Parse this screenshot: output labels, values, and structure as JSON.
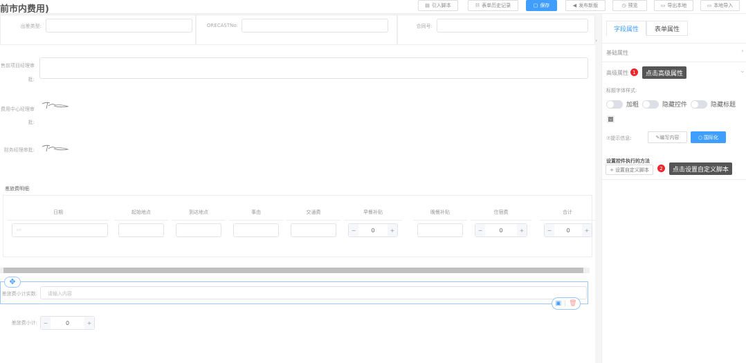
{
  "header": {
    "title": "前市内费用)"
  },
  "toolbar": [
    {
      "label": "引入脚本",
      "icon": "▤"
    },
    {
      "label": "表单历史记录",
      "icon": "☷"
    },
    {
      "label": "保存",
      "icon": "▢"
    },
    {
      "label": "发布新版",
      "icon": "◀"
    },
    {
      "label": "预览",
      "icon": "◷"
    },
    {
      "label": "导出本地",
      "icon": "▭"
    },
    {
      "label": "本地导入",
      "icon": "▭"
    }
  ],
  "form": {
    "trip_type_label": "出差类型:",
    "forecast_label": "ORECASTNo:",
    "contract_label": "合同号:",
    "presales_label_1": "售前项目经理审",
    "presales_label_2": "批:",
    "cost_center_label_1": "费用中心经理审",
    "cost_center_label_2": "批:",
    "finance_label": "财务经理审批:",
    "section_title": "差旅费明细",
    "columns": [
      "日期",
      "起始地点",
      "到达地点",
      "事由",
      "交通费",
      "早餐补贴",
      "晚餐补贴",
      "住宿费",
      "合计"
    ],
    "row_values": {
      "breakfast": "0",
      "lodging": "0",
      "total": "0"
    },
    "subtotal_actual_label": "差旅费小计实数:",
    "subtotal_actual_placeholder": "请输入内容",
    "subtotal_label": "差旅费小计:",
    "subtotal_value": "0"
  },
  "panel": {
    "tabs": [
      "字段属性",
      "表单属性"
    ],
    "basic": "基础属性",
    "advanced": "高级属性",
    "font_style_label": "标题字体样式:",
    "toggles": [
      "加粗",
      "隐藏控件",
      "隐藏标题"
    ],
    "hint_label": "⑦提示信息:",
    "edit_content": "✎编写内容",
    "i18n": "国际化",
    "method_title": "设置控件执行的方法",
    "custom_script": "设置自定义脚本",
    "callouts": [
      {
        "num": "1",
        "text": "点击高级属性"
      },
      {
        "num": "2",
        "text": "点击设置自定义脚本"
      }
    ]
  }
}
